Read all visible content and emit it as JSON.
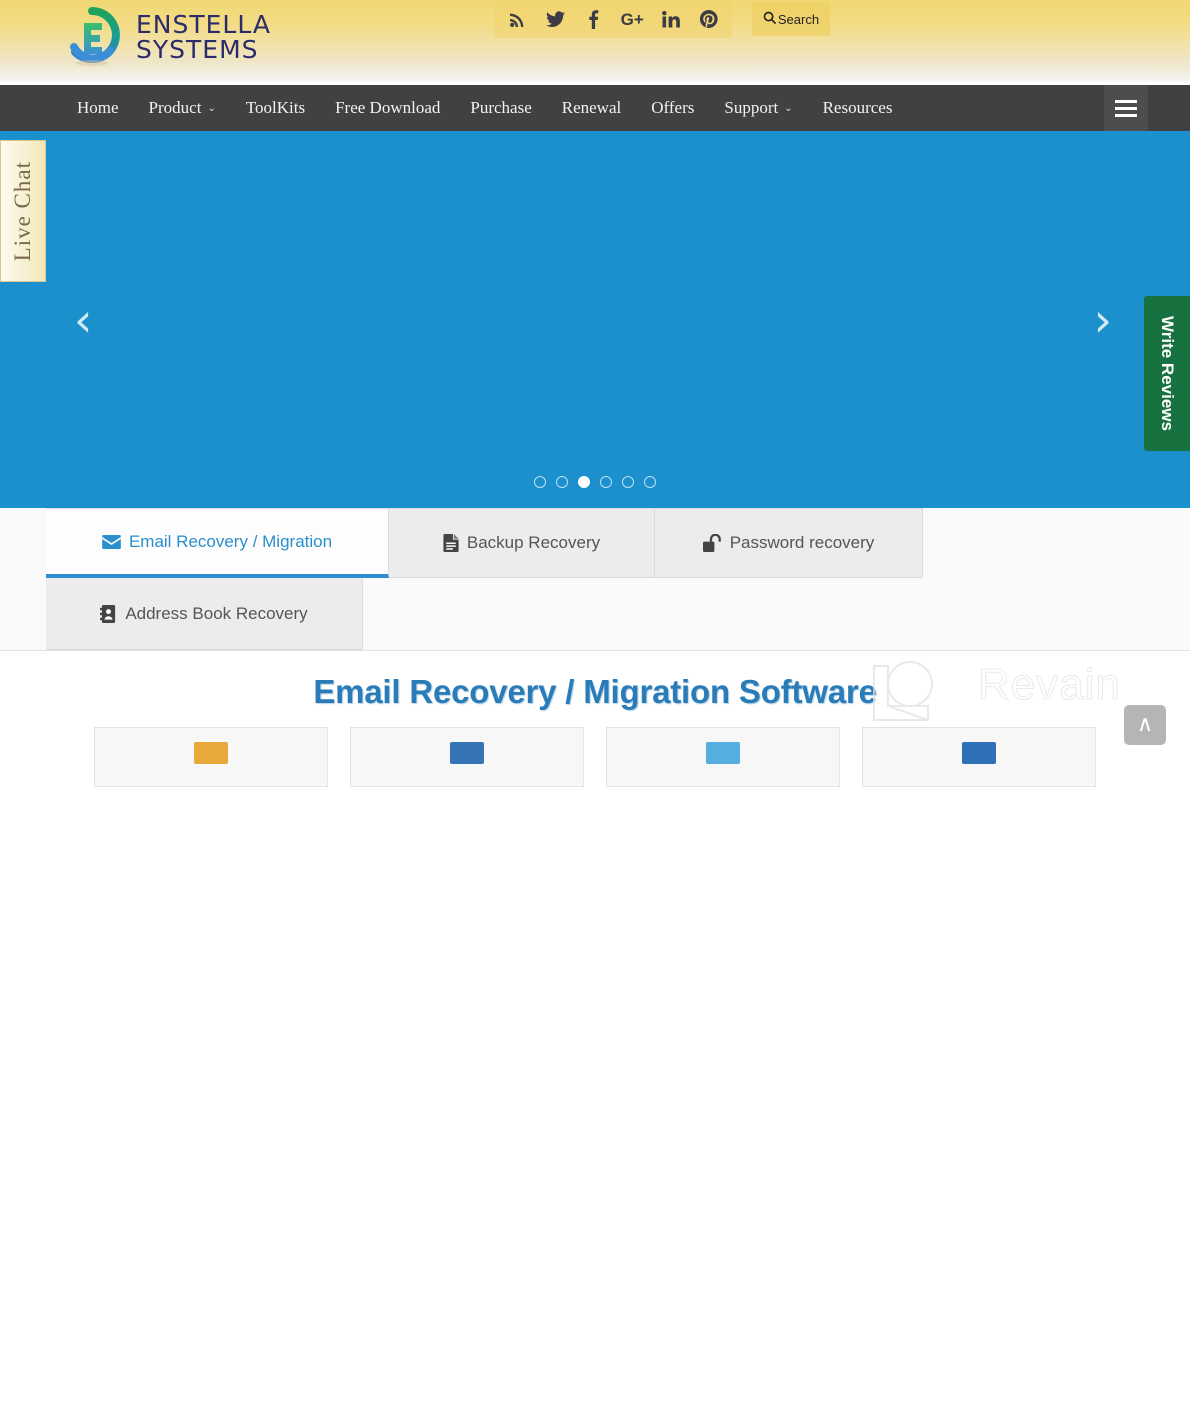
{
  "header": {
    "logo": {
      "line1": "ENSTELLA",
      "line2": "SYSTEMS",
      "icon": "enstella-logo-icon"
    },
    "social": [
      {
        "name": "rss-icon",
        "glyph": "⤧",
        "label": "RSS"
      },
      {
        "name": "twitter-icon",
        "glyph": "𝕏",
        "label": "Twitter"
      },
      {
        "name": "facebook-icon",
        "glyph": "f",
        "label": "Facebook"
      },
      {
        "name": "google-plus-icon",
        "glyph": "G+",
        "label": "Google Plus"
      },
      {
        "name": "linkedin-icon",
        "glyph": "in",
        "label": "LinkedIn"
      },
      {
        "name": "pinterest-icon",
        "glyph": "Ⓟ",
        "label": "Pinterest"
      }
    ],
    "search": {
      "label": "Search",
      "icon": "search-icon",
      "glyph": "🔍"
    }
  },
  "nav": {
    "items": [
      {
        "label": "Home",
        "has_caret": false
      },
      {
        "label": "Product",
        "has_caret": true
      },
      {
        "label": "ToolKits",
        "has_caret": false
      },
      {
        "label": "Free Download",
        "has_caret": false
      },
      {
        "label": "Purchase",
        "has_caret": false
      },
      {
        "label": "Renewal",
        "has_caret": false
      },
      {
        "label": "Offers",
        "has_caret": false
      },
      {
        "label": "Support",
        "has_caret": true
      },
      {
        "label": "Resources",
        "has_caret": false
      }
    ],
    "caret_glyph": "⌄",
    "menu_toggle": "hamburger-menu-icon"
  },
  "side_tabs": {
    "live_chat": "Live Chat",
    "write_reviews": "Write Reviews"
  },
  "carousel": {
    "background_color": "#1b90cc",
    "prev_glyph": "‹",
    "next_glyph": "›",
    "slide_count": 6,
    "active_slide": 3
  },
  "tabs": [
    {
      "label": "Email Recovery / Migration",
      "icon": "envelope-icon",
      "active": true
    },
    {
      "label": "Backup Recovery",
      "icon": "document-icon",
      "active": false
    },
    {
      "label": "Password recovery",
      "icon": "unlock-icon",
      "active": false
    },
    {
      "label": "Address Book Recovery",
      "icon": "address-book-icon",
      "active": false
    }
  ],
  "content": {
    "heading": "Email Recovery / Migration Software",
    "heading_color": "#2a7cb8",
    "cards": [
      {
        "icon": "product-icon-orange",
        "color": "#e8a93a"
      },
      {
        "icon": "product-icon-blue",
        "color": "#3575b5"
      },
      {
        "icon": "product-icon-lightblue",
        "color": "#56aee0"
      },
      {
        "icon": "product-icon-blue-2",
        "color": "#2f6fb5"
      }
    ]
  },
  "watermark": {
    "text": "Revain",
    "logo": "revain-logo-icon"
  },
  "scroll_top": {
    "glyph": "∧",
    "label": "scroll-to-top"
  }
}
